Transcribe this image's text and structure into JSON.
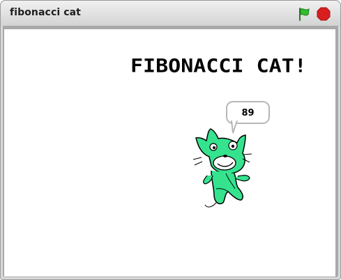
{
  "window": {
    "title": "fibonacci cat"
  },
  "controls": {
    "flag_icon": "green-flag-icon",
    "stop_icon": "stop-icon"
  },
  "stage": {
    "title_text": "FIBONACCI CAT!",
    "speech_bubble_text": "89",
    "sprite": "green-cat"
  },
  "colors": {
    "flag": "#2fbf2f",
    "stop": "#d81f1f",
    "cat": "#35e38f"
  }
}
